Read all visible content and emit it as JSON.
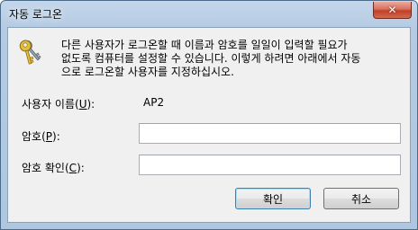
{
  "window": {
    "title": "자동 로그온",
    "close_glyph": "✕"
  },
  "description": "다른 사용자가 로그온할 때 이름과 암호를 일일이 입력할 필요가\n없도록 컴퓨터를 설정할 수 있습니다. 이렇게 하려면 아래에서 자동\n으로 로그온할 사용자를 지정하십시오.",
  "icon": {
    "name": "keys-icon",
    "color": "#d8b030"
  },
  "fields": {
    "username": {
      "label_prefix": "사용자 이름(",
      "label_key": "U",
      "label_suffix": "):",
      "value": "AP2"
    },
    "password": {
      "label_prefix": "암호(",
      "label_key": "P",
      "label_suffix": "):",
      "value": ""
    },
    "confirm": {
      "label_prefix": "암호 확인(",
      "label_key": "C",
      "label_suffix": "):",
      "value": ""
    }
  },
  "buttons": {
    "ok": "확인",
    "cancel": "취소"
  },
  "colors": {
    "titlebar": "#b5cbe3",
    "client": "#f0f0f0",
    "close": "#c23f26",
    "default_button_border": "#3c7fb1"
  }
}
